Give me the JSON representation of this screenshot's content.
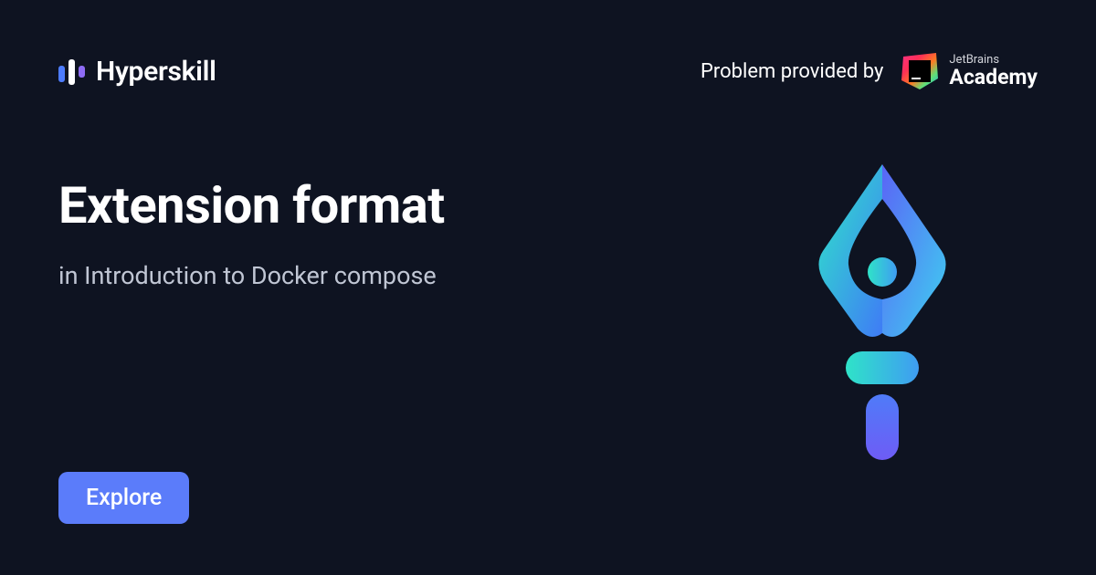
{
  "brand": {
    "name": "Hyperskill"
  },
  "provider": {
    "prefix": "Problem provided by",
    "company_small": "JetBrains",
    "company_big": "Academy"
  },
  "main": {
    "title": "Extension format",
    "subtitle": "in Introduction to Docker compose"
  },
  "cta": {
    "explore_label": "Explore"
  }
}
